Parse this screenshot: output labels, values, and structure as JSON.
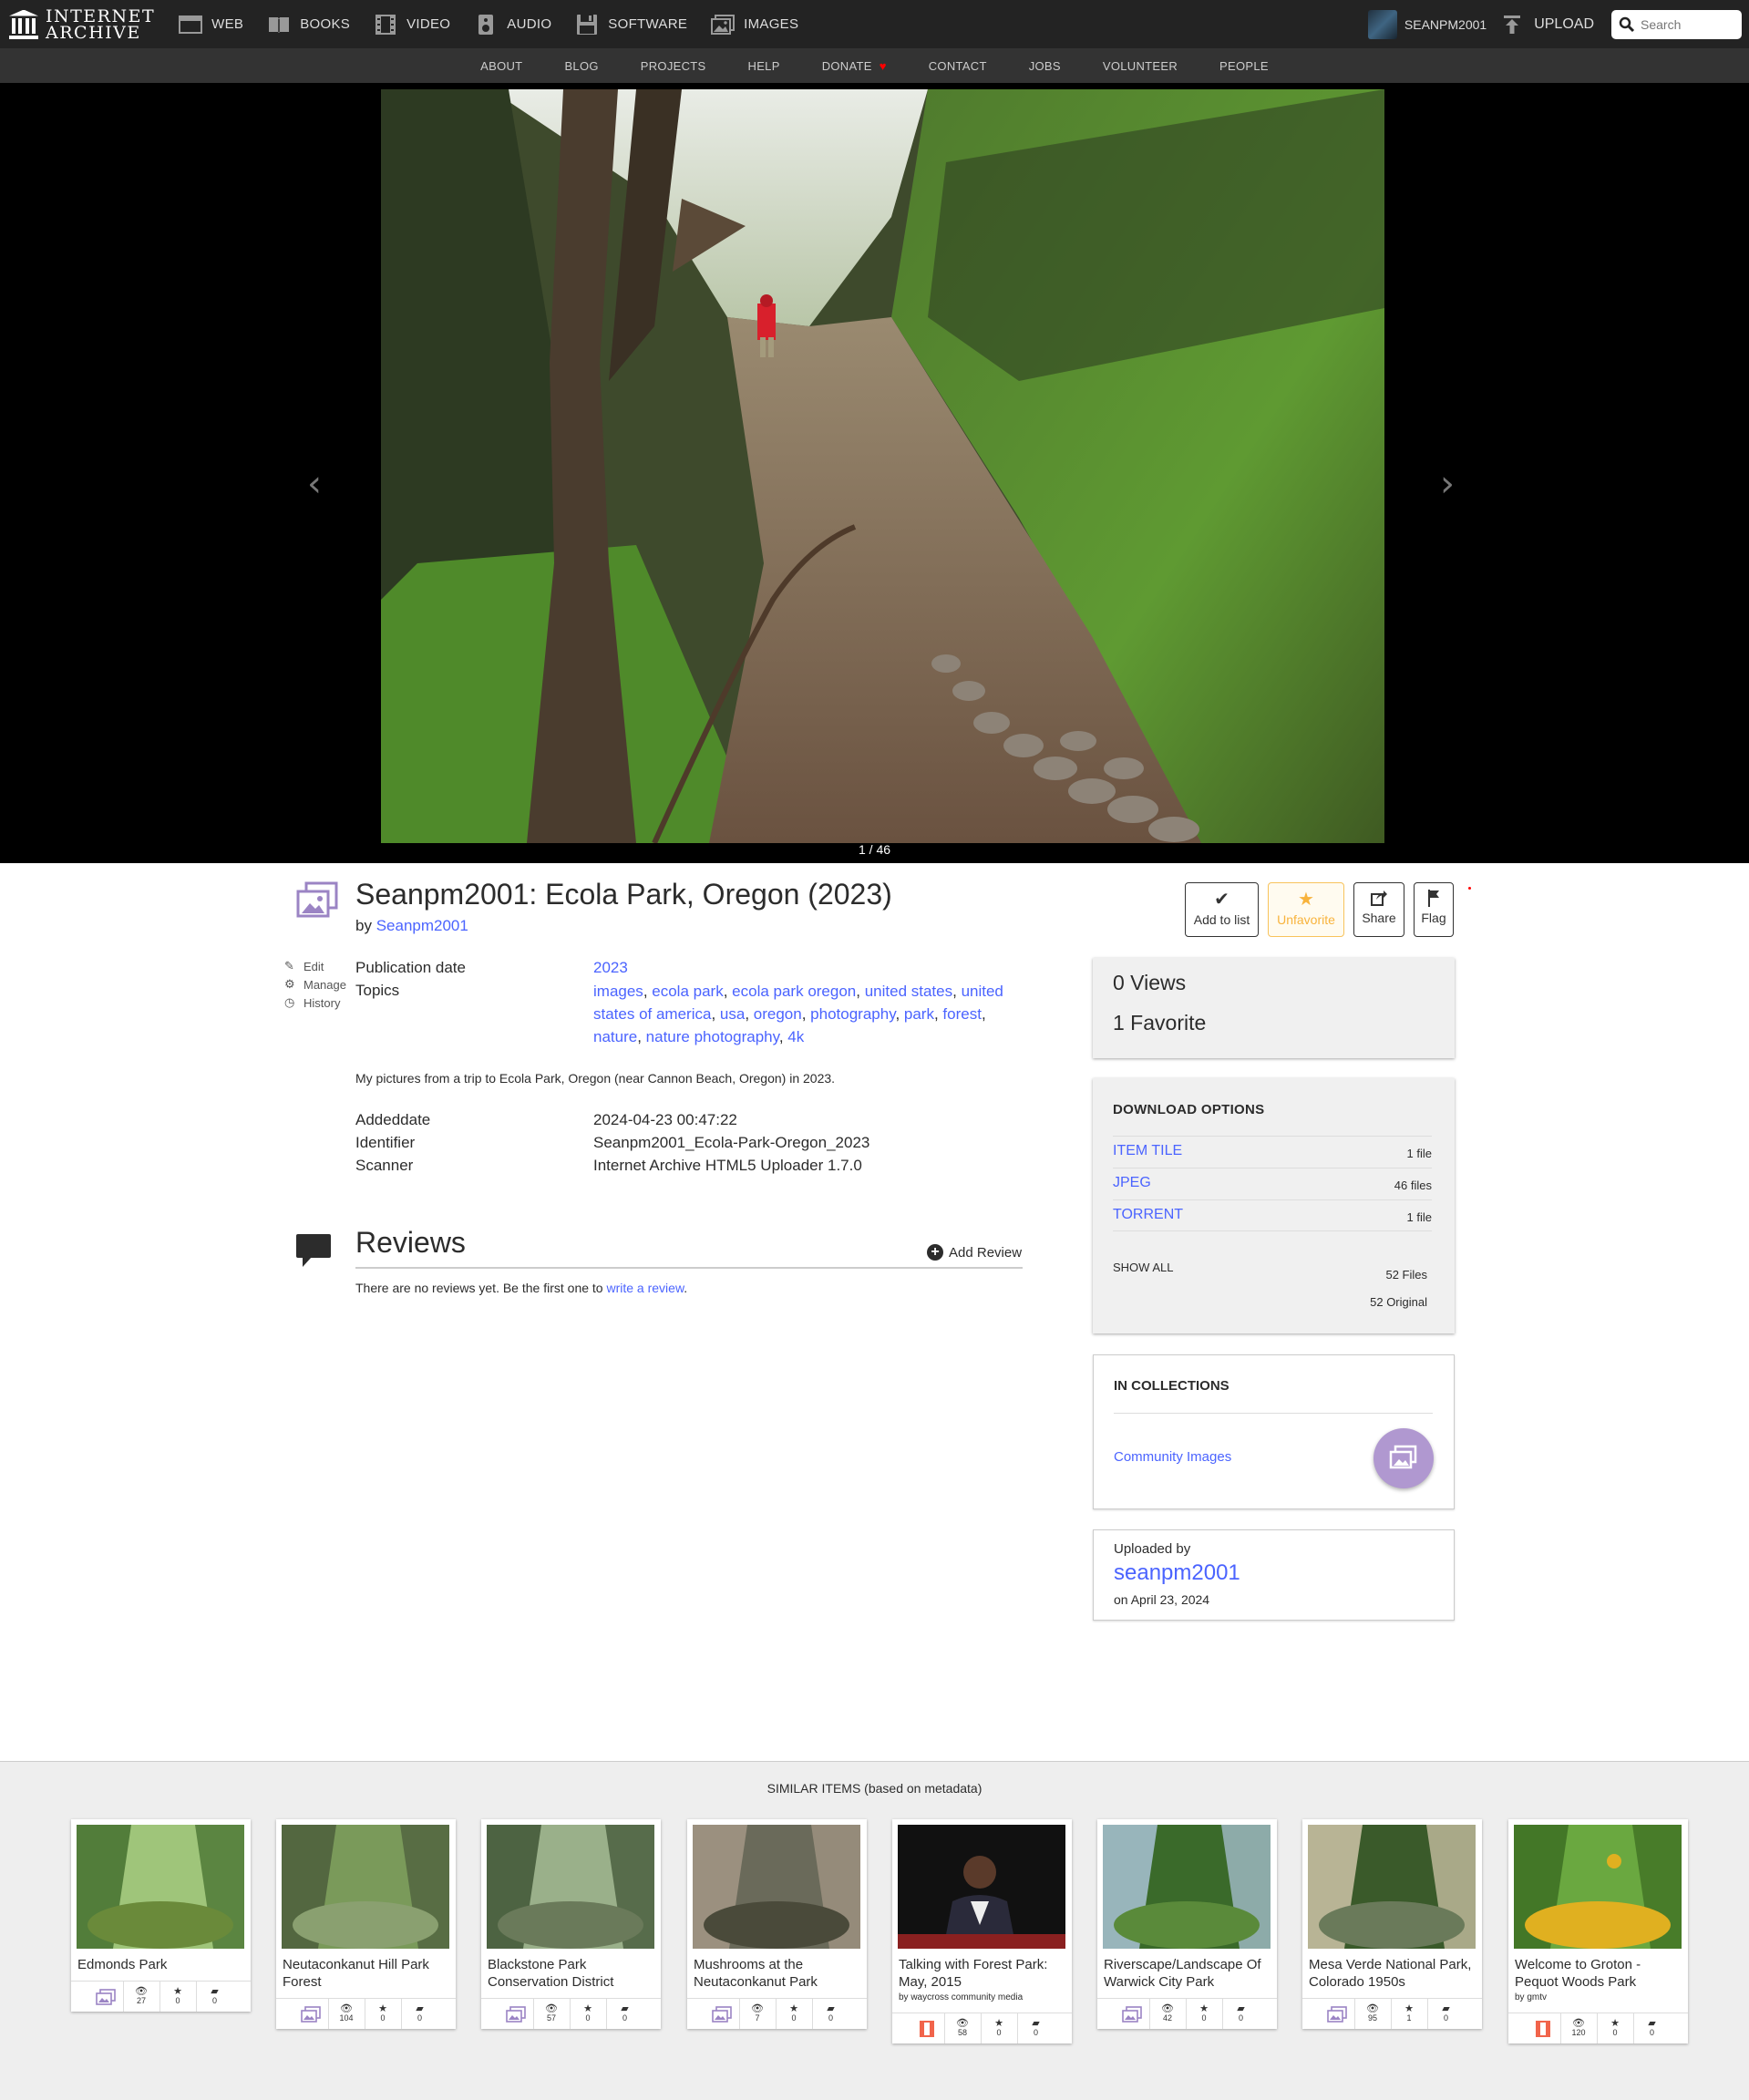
{
  "topnav": {
    "logo_line1": "INTERNET",
    "logo_line2": "ARCHIVE",
    "items": [
      {
        "label": "WEB",
        "icon": "web-icon"
      },
      {
        "label": "BOOKS",
        "icon": "books-icon"
      },
      {
        "label": "VIDEO",
        "icon": "video-icon"
      },
      {
        "label": "AUDIO",
        "icon": "audio-icon"
      },
      {
        "label": "SOFTWARE",
        "icon": "software-icon"
      },
      {
        "label": "IMAGES",
        "icon": "images-icon"
      }
    ],
    "username": "SEANPM2001",
    "upload_label": "UPLOAD",
    "search_placeholder": "Search"
  },
  "subnav": [
    "ABOUT",
    "BLOG",
    "PROJECTS",
    "HELP",
    "DONATE",
    "CONTACT",
    "JOBS",
    "VOLUNTEER",
    "PEOPLE"
  ],
  "theater": {
    "pager": "1 / 46",
    "prev_glyph": "‹",
    "next_glyph": "›"
  },
  "item": {
    "title": "Seanpm2001: Ecola Park, Oregon (2023)",
    "by_prefix": "by",
    "creator": "Seanpm2001",
    "actions": {
      "add_to_list": "Add to list",
      "unfavorite": "Unfavorite",
      "share": "Share",
      "flag": "Flag"
    },
    "side_links": [
      "Edit",
      "Manage",
      "History"
    ],
    "metadata": {
      "publication_date_label": "Publication date",
      "publication_date": "2023",
      "topics_label": "Topics",
      "topics": [
        "images",
        "ecola park",
        "ecola park oregon",
        "united states",
        "united states of america",
        "usa",
        "oregon",
        "photography",
        "park",
        "forest",
        "nature",
        "nature photography",
        "4k"
      ],
      "description": "My pictures from a trip to Ecola Park, Oregon (near Cannon Beach, Oregon) in 2023.",
      "addeddate_label": "Addeddate",
      "addeddate": "2024-04-23 00:47:22",
      "identifier_label": "Identifier",
      "identifier": "Seanpm2001_Ecola-Park-Oregon_2023",
      "scanner_label": "Scanner",
      "scanner": "Internet Archive HTML5 Uploader 1.7.0"
    }
  },
  "reviews": {
    "title": "Reviews",
    "add_label": "Add Review",
    "empty_prefix": "There are no reviews yet. Be the first one to",
    "empty_link": "write a review",
    "empty_suffix": "."
  },
  "stats": {
    "views": "0 Views",
    "favorites": "1 Favorite"
  },
  "downloads": {
    "title": "DOWNLOAD OPTIONS",
    "rows": [
      {
        "label": "ITEM TILE",
        "count": "1 file"
      },
      {
        "label": "JPEG",
        "count": "46 files"
      },
      {
        "label": "TORRENT",
        "count": "1 file"
      }
    ],
    "show_all": "SHOW ALL",
    "total_files": "52 Files",
    "total_original": "52 Original"
  },
  "collections": {
    "title": "IN COLLECTIONS",
    "items": [
      "Community Images"
    ]
  },
  "uploader": {
    "label": "Uploaded by",
    "name": "seanpm2001",
    "date": "on April 23, 2024"
  },
  "similar": {
    "title": "SIMILAR ITEMS (based on metadata)",
    "items": [
      {
        "title": "Edmonds Park",
        "by": "",
        "type": "image",
        "views": "27",
        "favs": "0",
        "reviews": "0"
      },
      {
        "title": "Neutaconkanut Hill Park Forest",
        "by": "",
        "type": "image",
        "views": "104",
        "favs": "0",
        "reviews": "0"
      },
      {
        "title": "Blackstone Park Conservation District",
        "by": "",
        "type": "image",
        "views": "57",
        "favs": "0",
        "reviews": "0"
      },
      {
        "title": "Mushrooms at the Neutaconkanut Park",
        "by": "",
        "type": "image",
        "views": "7",
        "favs": "0",
        "reviews": "0"
      },
      {
        "title": "Talking with Forest Park: May, 2015",
        "by": "by waycross community media",
        "type": "movie",
        "views": "58",
        "favs": "0",
        "reviews": "0"
      },
      {
        "title": "Riverscape/Landscape Of Warwick City Park",
        "by": "",
        "type": "image",
        "views": "42",
        "favs": "0",
        "reviews": "0"
      },
      {
        "title": "Mesa Verde National Park, Colorado 1950s",
        "by": "",
        "type": "image",
        "views": "95",
        "favs": "1",
        "reviews": "0"
      },
      {
        "title": "Welcome to Groton - Pequot Woods Park",
        "by": "by gmtv",
        "type": "movie",
        "views": "120",
        "favs": "0",
        "reviews": "0"
      }
    ]
  },
  "colors": {
    "link": "#4b64ff",
    "topnav_bg": "#232323",
    "subnav_bg": "#333333",
    "favorite": "#f8b33c",
    "image_icon": "#9b84c4",
    "movie_icon": "#f1644b"
  }
}
